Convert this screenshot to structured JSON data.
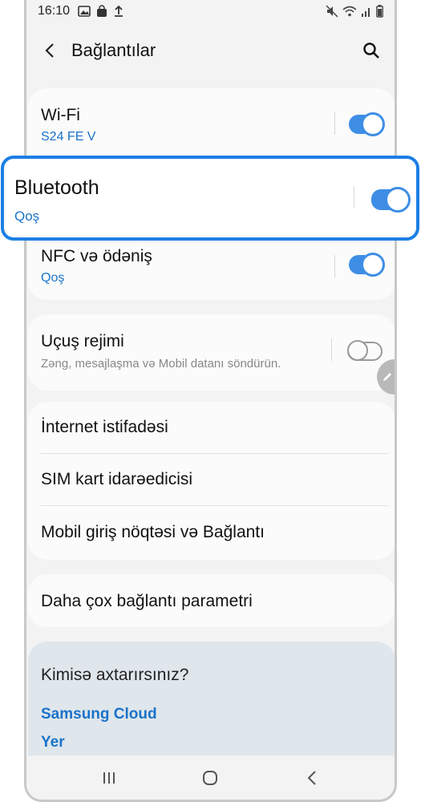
{
  "status_bar": {
    "time": "16:10",
    "left_icons": [
      "image-icon",
      "bag-icon",
      "upload-icon"
    ],
    "right_icons": [
      "mute-icon",
      "wifi-icon",
      "signal-icon",
      "battery-icon"
    ]
  },
  "header": {
    "title": "Bağlantılar"
  },
  "sections": {
    "wifi": {
      "label": "Wi-Fi",
      "sub": "S24 FE V",
      "toggle": "on"
    },
    "bluetooth": {
      "label": "Bluetooth",
      "sub": "Qoş",
      "toggle": "on"
    },
    "nfc": {
      "label": "NFC və ödəniş",
      "sub": "Qoş",
      "toggle": "on"
    },
    "flight": {
      "label": "Uçuş rejimi",
      "sub": "Zəng, mesajlaşma və Mobil datanı söndürün.",
      "toggle": "off"
    },
    "internet": {
      "label": "İnternet istifadəsi"
    },
    "sim": {
      "label": "SIM kart idarəedicisi"
    },
    "hotspot": {
      "label": "Mobil giriş nöqtəsi və Bağlantı"
    },
    "more": {
      "label": "Daha çox bağlantı parametri"
    }
  },
  "suggestions": {
    "question": "Kimisə axtarırsınız?",
    "links": [
      "Samsung Cloud",
      "Yer"
    ]
  },
  "colors": {
    "accent": "#1a73c9",
    "toggle_on": "#3e8ee6",
    "highlight_border": "#1c7fe4"
  }
}
